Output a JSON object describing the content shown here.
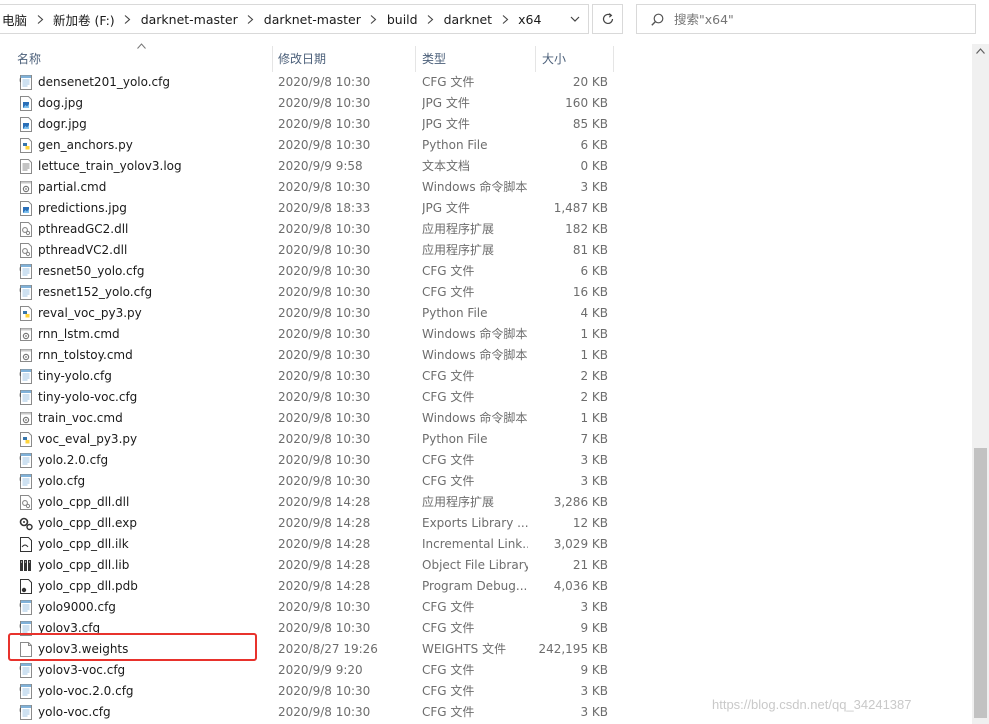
{
  "address_bar": {
    "breadcrumbs": [
      "电脑",
      "新加卷 (F:)",
      "darknet-master",
      "darknet-master",
      "build",
      "darknet",
      "x64"
    ]
  },
  "search": {
    "placeholder": "搜索\"x64\""
  },
  "columns": {
    "name": "名称",
    "date": "修改日期",
    "type": "类型",
    "size": "大小"
  },
  "files": [
    {
      "name": "densenet201_yolo.cfg",
      "date": "2020/9/8 10:30",
      "type": "CFG 文件",
      "size": "20 KB",
      "icon": "cfg-file-icon"
    },
    {
      "name": "dog.jpg",
      "date": "2020/9/8 10:30",
      "type": "JPG 文件",
      "size": "160 KB",
      "icon": "image-file-icon"
    },
    {
      "name": "dogr.jpg",
      "date": "2020/9/8 10:30",
      "type": "JPG 文件",
      "size": "85 KB",
      "icon": "image-file-icon"
    },
    {
      "name": "gen_anchors.py",
      "date": "2020/9/8 10:30",
      "type": "Python File",
      "size": "6 KB",
      "icon": "python-file-icon"
    },
    {
      "name": "lettuce_train_yolov3.log",
      "date": "2020/9/9 9:58",
      "type": "文本文档",
      "size": "0 KB",
      "icon": "text-file-icon"
    },
    {
      "name": "partial.cmd",
      "date": "2020/9/8 10:30",
      "type": "Windows 命令脚本",
      "size": "3 KB",
      "icon": "cmd-file-icon"
    },
    {
      "name": "predictions.jpg",
      "date": "2020/9/8 18:33",
      "type": "JPG 文件",
      "size": "1,487 KB",
      "icon": "image-file-icon"
    },
    {
      "name": "pthreadGC2.dll",
      "date": "2020/9/8 10:30",
      "type": "应用程序扩展",
      "size": "182 KB",
      "icon": "dll-file-icon"
    },
    {
      "name": "pthreadVC2.dll",
      "date": "2020/9/8 10:30",
      "type": "应用程序扩展",
      "size": "81 KB",
      "icon": "dll-file-icon"
    },
    {
      "name": "resnet50_yolo.cfg",
      "date": "2020/9/8 10:30",
      "type": "CFG 文件",
      "size": "6 KB",
      "icon": "cfg-file-icon"
    },
    {
      "name": "resnet152_yolo.cfg",
      "date": "2020/9/8 10:30",
      "type": "CFG 文件",
      "size": "16 KB",
      "icon": "cfg-file-icon"
    },
    {
      "name": "reval_voc_py3.py",
      "date": "2020/9/8 10:30",
      "type": "Python File",
      "size": "4 KB",
      "icon": "python-file-icon"
    },
    {
      "name": "rnn_lstm.cmd",
      "date": "2020/9/8 10:30",
      "type": "Windows 命令脚本",
      "size": "1 KB",
      "icon": "cmd-file-icon"
    },
    {
      "name": "rnn_tolstoy.cmd",
      "date": "2020/9/8 10:30",
      "type": "Windows 命令脚本",
      "size": "1 KB",
      "icon": "cmd-file-icon"
    },
    {
      "name": "tiny-yolo.cfg",
      "date": "2020/9/8 10:30",
      "type": "CFG 文件",
      "size": "2 KB",
      "icon": "cfg-file-icon"
    },
    {
      "name": "tiny-yolo-voc.cfg",
      "date": "2020/9/8 10:30",
      "type": "CFG 文件",
      "size": "2 KB",
      "icon": "cfg-file-icon"
    },
    {
      "name": "train_voc.cmd",
      "date": "2020/9/8 10:30",
      "type": "Windows 命令脚本",
      "size": "1 KB",
      "icon": "cmd-file-icon"
    },
    {
      "name": "voc_eval_py3.py",
      "date": "2020/9/8 10:30",
      "type": "Python File",
      "size": "7 KB",
      "icon": "python-file-icon"
    },
    {
      "name": "yolo.2.0.cfg",
      "date": "2020/9/8 10:30",
      "type": "CFG 文件",
      "size": "3 KB",
      "icon": "cfg-file-icon"
    },
    {
      "name": "yolo.cfg",
      "date": "2020/9/8 10:30",
      "type": "CFG 文件",
      "size": "3 KB",
      "icon": "cfg-file-icon"
    },
    {
      "name": "yolo_cpp_dll.dll",
      "date": "2020/9/8 14:28",
      "type": "应用程序扩展",
      "size": "3,286 KB",
      "icon": "dll-file-icon"
    },
    {
      "name": "yolo_cpp_dll.exp",
      "date": "2020/9/8 14:28",
      "type": "Exports Library ...",
      "size": "12 KB",
      "icon": "exp-file-icon"
    },
    {
      "name": "yolo_cpp_dll.ilk",
      "date": "2020/9/8 14:28",
      "type": "Incremental Link...",
      "size": "3,029 KB",
      "icon": "ilk-file-icon"
    },
    {
      "name": "yolo_cpp_dll.lib",
      "date": "2020/9/8 14:28",
      "type": "Object File Library",
      "size": "21 KB",
      "icon": "lib-file-icon"
    },
    {
      "name": "yolo_cpp_dll.pdb",
      "date": "2020/9/8 14:28",
      "type": "Program Debug...",
      "size": "4,036 KB",
      "icon": "pdb-file-icon"
    },
    {
      "name": "yolo9000.cfg",
      "date": "2020/9/8 10:30",
      "type": "CFG 文件",
      "size": "3 KB",
      "icon": "cfg-file-icon"
    },
    {
      "name": "yolov3.cfg",
      "date": "2020/9/8 10:30",
      "type": "CFG 文件",
      "size": "9 KB",
      "icon": "cfg-file-icon"
    },
    {
      "name": "yolov3.weights",
      "date": "2020/8/27 19:26",
      "type": "WEIGHTS 文件",
      "size": "242,195 KB",
      "icon": "blank-file-icon",
      "highlighted": true
    },
    {
      "name": "yolov3-voc.cfg",
      "date": "2020/9/9 9:20",
      "type": "CFG 文件",
      "size": "9 KB",
      "icon": "cfg-file-icon"
    },
    {
      "name": "yolo-voc.2.0.cfg",
      "date": "2020/9/8 10:30",
      "type": "CFG 文件",
      "size": "3 KB",
      "icon": "cfg-file-icon"
    },
    {
      "name": "yolo-voc.cfg",
      "date": "2020/9/8 10:30",
      "type": "CFG 文件",
      "size": "3 KB",
      "icon": "cfg-file-icon"
    }
  ],
  "highlight_color": "#e8322c",
  "watermark": "https://blog.csdn.net/qq_34241387"
}
